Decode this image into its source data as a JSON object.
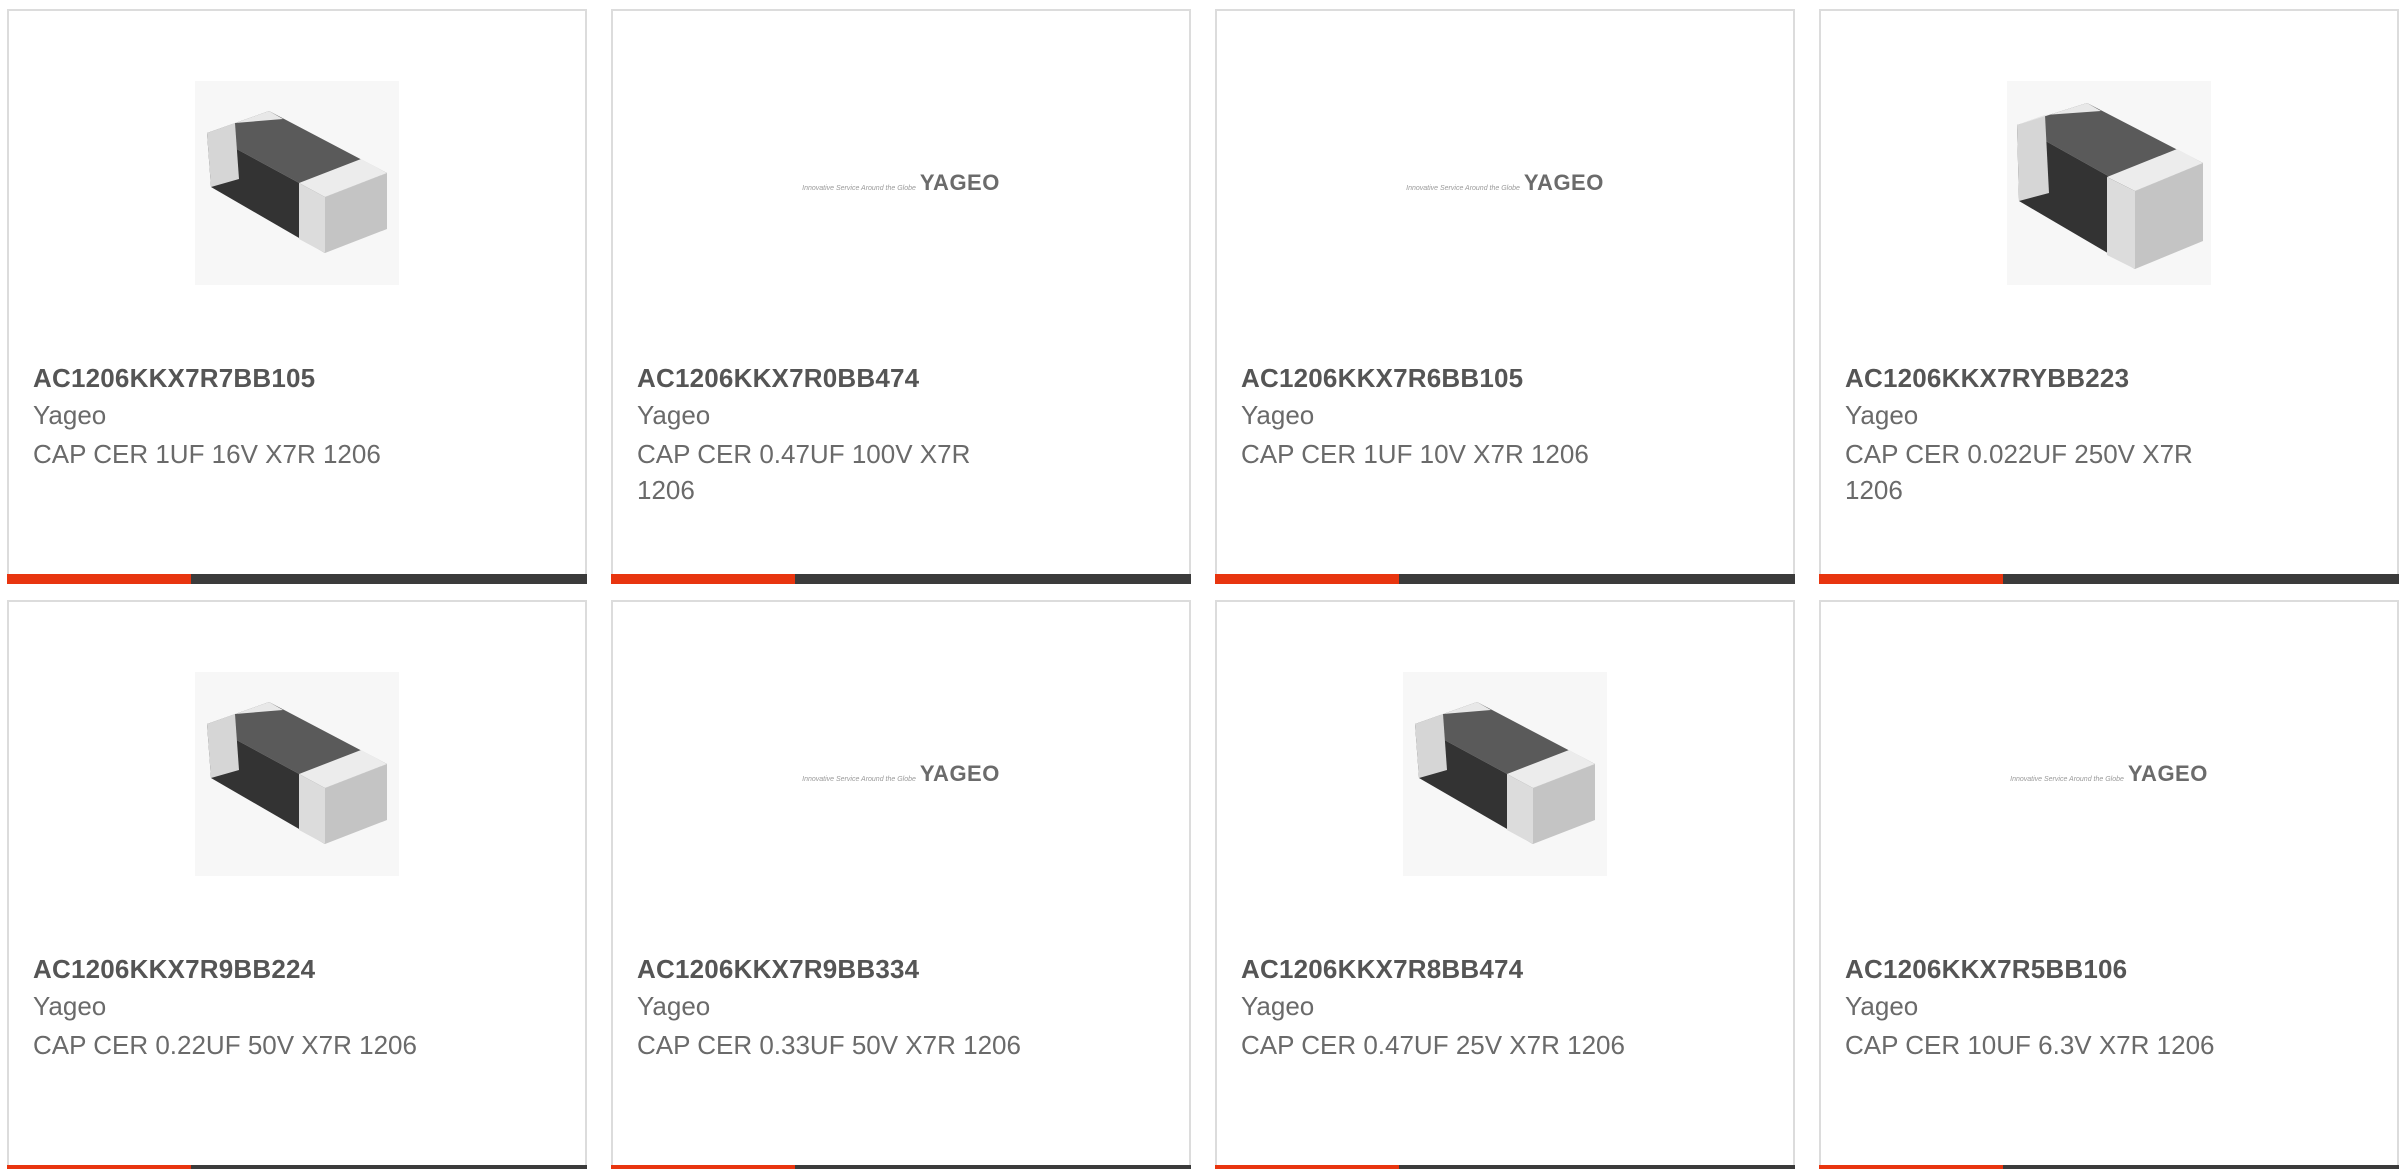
{
  "colors": {
    "accent": "#e8350f",
    "bar_dark": "#3b3b3b",
    "border": "#dcdcdc"
  },
  "products": [
    {
      "part_number": "AC1206KKX7R7BB105",
      "manufacturer": "Yageo",
      "description": "CAP CER 1UF 16V X7R 1206",
      "image": "chip-capacitor-image"
    },
    {
      "part_number": "AC1206KKX7R0BB474",
      "manufacturer": "Yageo",
      "description": "CAP CER 0.47UF 100V X7R 1206",
      "image": "yageo-logo-image"
    },
    {
      "part_number": "AC1206KKX7R6BB105",
      "manufacturer": "Yageo",
      "description": "CAP CER 1UF 10V X7R 1206",
      "image": "yageo-logo-image"
    },
    {
      "part_number": "AC1206KKX7RYBB223",
      "manufacturer": "Yageo",
      "description": "CAP CER 0.022UF 250V X7R 1206",
      "image": "chip-capacitor-image"
    },
    {
      "part_number": "AC1206KKX7R9BB224",
      "manufacturer": "Yageo",
      "description": "CAP CER 0.22UF 50V X7R 1206",
      "image": "chip-capacitor-image"
    },
    {
      "part_number": "AC1206KKX7R9BB334",
      "manufacturer": "Yageo",
      "description": "CAP CER 0.33UF 50V X7R 1206",
      "image": "yageo-logo-image"
    },
    {
      "part_number": "AC1206KKX7R8BB474",
      "manufacturer": "Yageo",
      "description": "CAP CER 0.47UF 25V X7R 1206",
      "image": "chip-capacitor-image"
    },
    {
      "part_number": "AC1206KKX7R5BB106",
      "manufacturer": "Yageo",
      "description": "CAP CER 10UF 6.3V X7R 1206",
      "image": "yageo-logo-image"
    }
  ],
  "logo": {
    "tagline": "Innovative Service Around the Globe",
    "wordmark": "YAGEO"
  }
}
